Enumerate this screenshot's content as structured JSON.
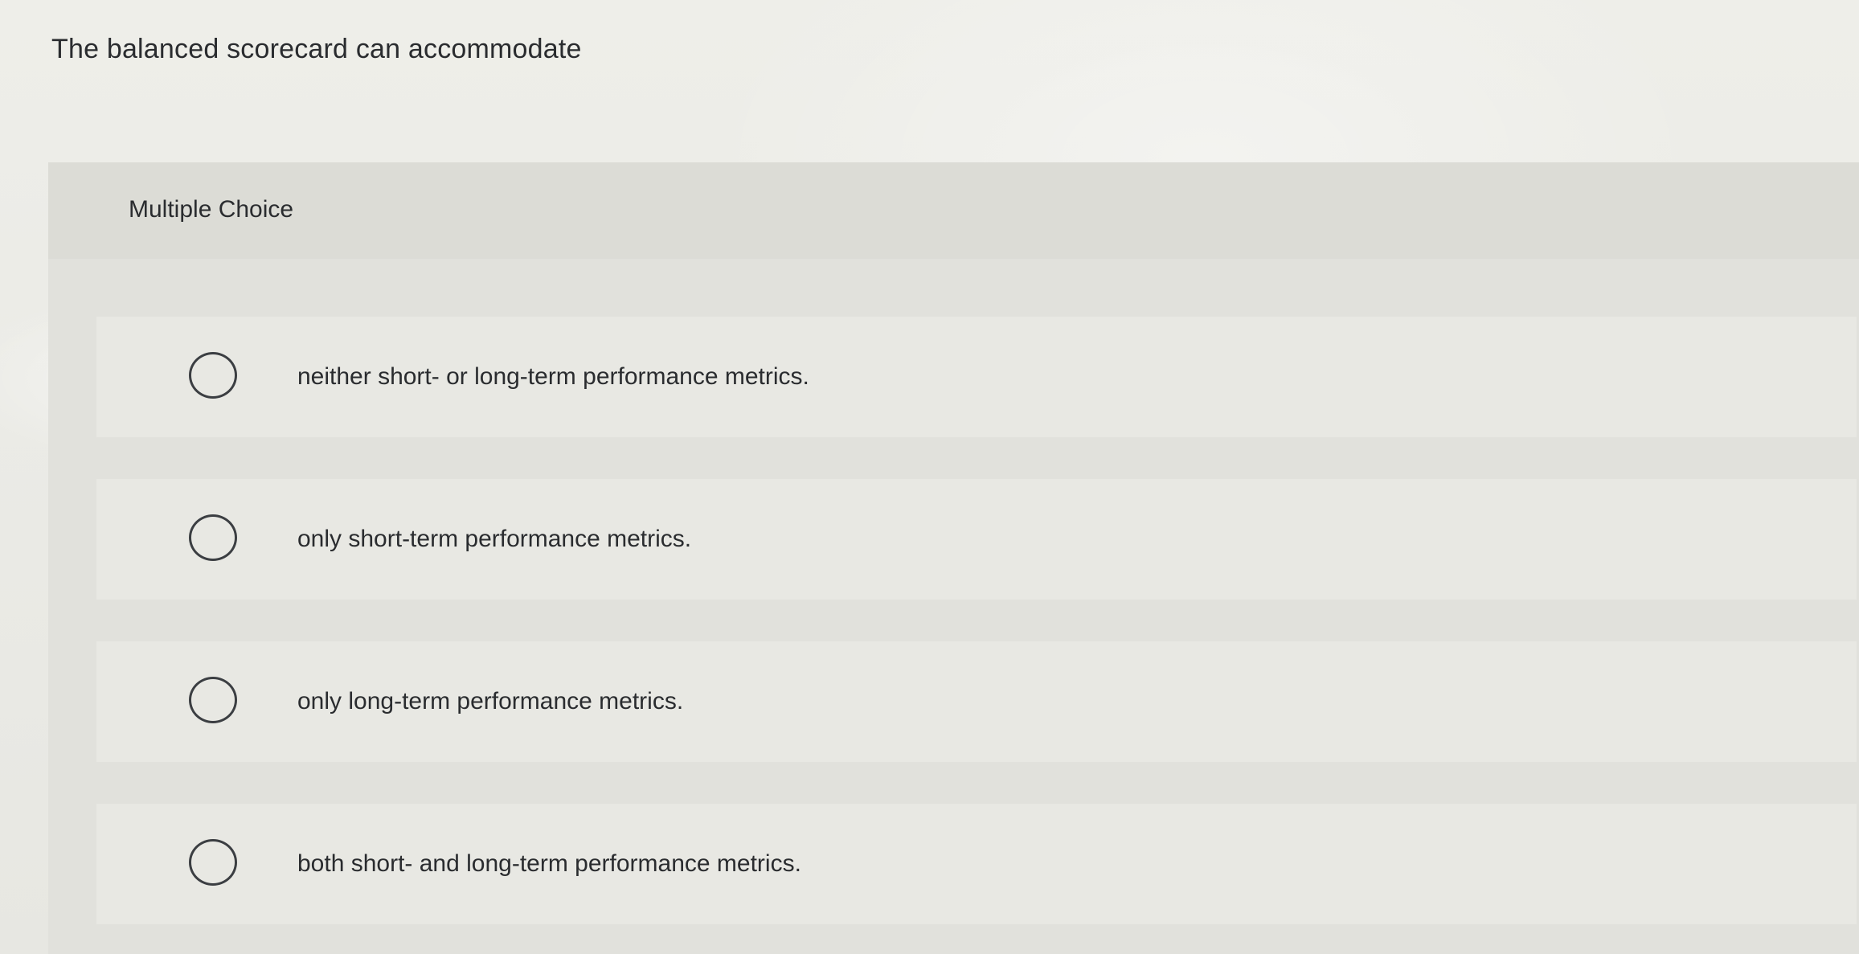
{
  "question": {
    "text": "The balanced scorecard can accommodate"
  },
  "panel": {
    "type_label": "Multiple Choice",
    "options": [
      {
        "label": "neither short- or long-term performance metrics.",
        "selected": false
      },
      {
        "label": "only short-term performance metrics.",
        "selected": false
      },
      {
        "label": "only long-term performance metrics.",
        "selected": false
      },
      {
        "label": "both short- and long-term performance metrics.",
        "selected": false
      }
    ]
  },
  "icons": {
    "radio": "radio-unchecked-icon"
  }
}
